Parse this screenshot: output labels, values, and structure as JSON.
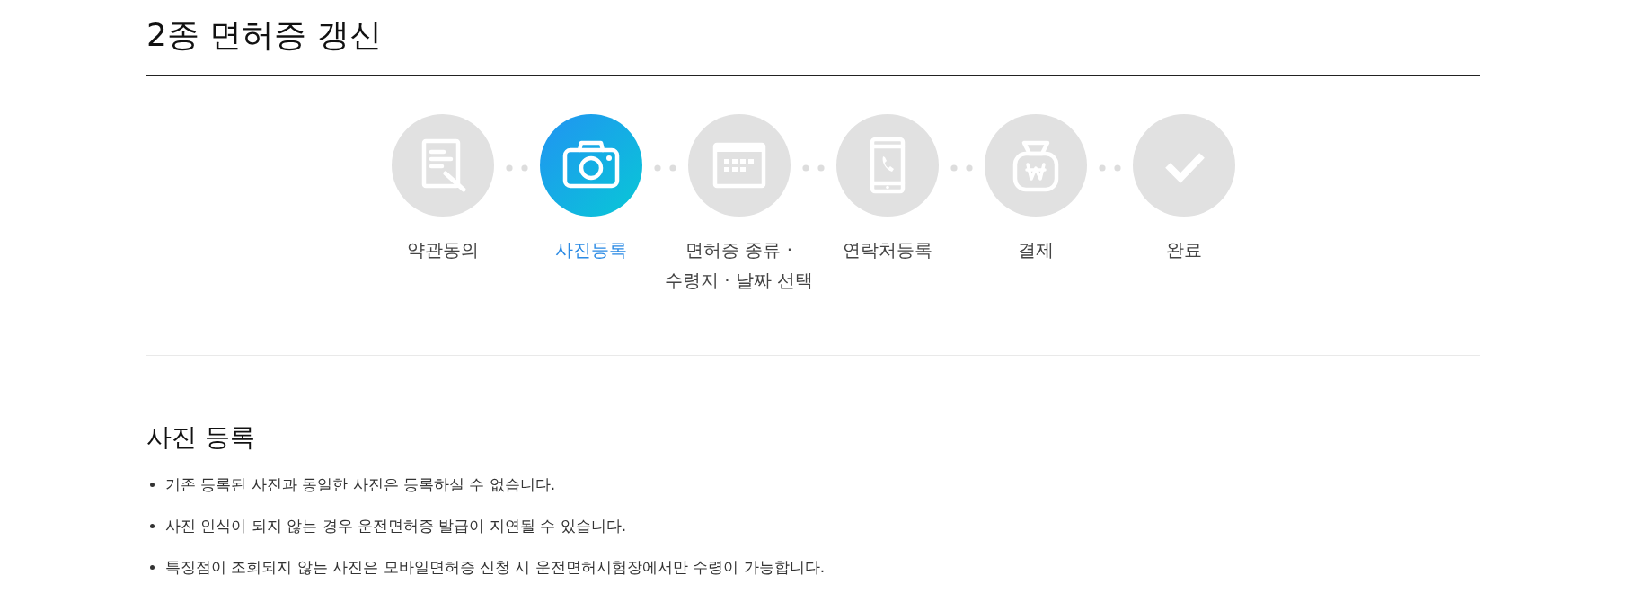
{
  "page": {
    "title": "2종 면허증 갱신"
  },
  "steps": [
    {
      "kind": "terms",
      "label": "약관동의",
      "selected": false
    },
    {
      "kind": "photo",
      "label": "사진등록",
      "selected": true
    },
    {
      "kind": "schedule",
      "label": "면허증 종류 · 수령지 · 날짜 선택",
      "selected": false
    },
    {
      "kind": "contact",
      "label": "연락처등록",
      "selected": false
    },
    {
      "kind": "payment",
      "label": "결제",
      "selected": false
    },
    {
      "kind": "done",
      "label": "완료",
      "selected": false
    }
  ],
  "section": {
    "heading": "사진 등록",
    "notes": [
      "기존 등록된 사진과 동일한 사진은 등록하실 수 없습니다.",
      "사진 인식이 되지 않는 경우 운전면허증 발급이 지연될 수 있습니다.",
      "특징점이 조회되지 않는 사진은 모바일면허증 신청 시 운전면허시험장에서만 수령이 가능합니다."
    ]
  }
}
